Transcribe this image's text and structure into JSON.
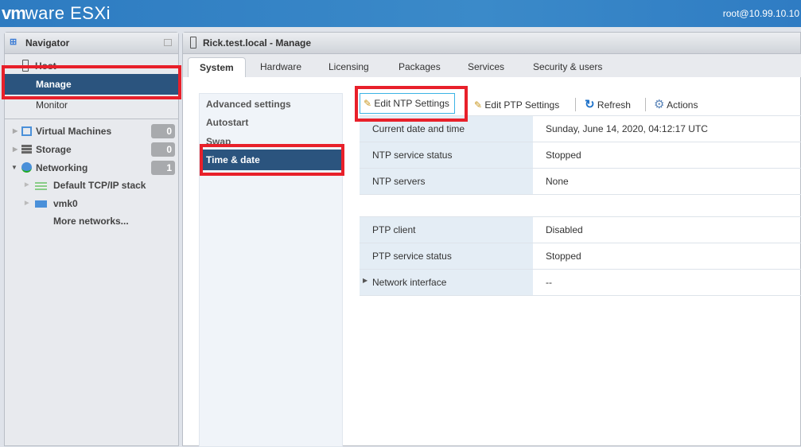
{
  "header": {
    "brand": "vm",
    "brand2": "ware",
    "product": "ESXi",
    "user": "root@10.99.10.10"
  },
  "navigator": {
    "title": "Navigator",
    "host": "Host",
    "manage": "Manage",
    "monitor": "Monitor",
    "items": [
      {
        "label": "Virtual Machines",
        "count": "0"
      },
      {
        "label": "Storage",
        "count": "0"
      },
      {
        "label": "Networking",
        "count": "1"
      }
    ],
    "networking_children": [
      "Default TCP/IP stack",
      "vmk0",
      "More networks..."
    ]
  },
  "main": {
    "title": "Rick.test.local - Manage",
    "tabs": [
      "System",
      "Hardware",
      "Licensing",
      "Packages",
      "Services",
      "Security & users"
    ],
    "side": [
      "Advanced settings",
      "Autostart",
      "Swap",
      "Time & date"
    ],
    "toolbar": {
      "edit_ntp": "Edit NTP Settings",
      "edit_ptp": "Edit PTP Settings",
      "refresh": "Refresh",
      "actions": "Actions"
    },
    "ntp": [
      {
        "k": "Current date and time",
        "v": "Sunday, June 14, 2020, 04:12:17 UTC"
      },
      {
        "k": "NTP service status",
        "v": "Stopped"
      },
      {
        "k": "NTP servers",
        "v": "None"
      }
    ],
    "ptp": [
      {
        "k": "PTP client",
        "v": "Disabled"
      },
      {
        "k": "PTP service status",
        "v": "Stopped"
      },
      {
        "k": "Network interface",
        "v": "--"
      }
    ]
  },
  "colors": {
    "accent": "#2b547e",
    "highlight": "#e8202a"
  }
}
